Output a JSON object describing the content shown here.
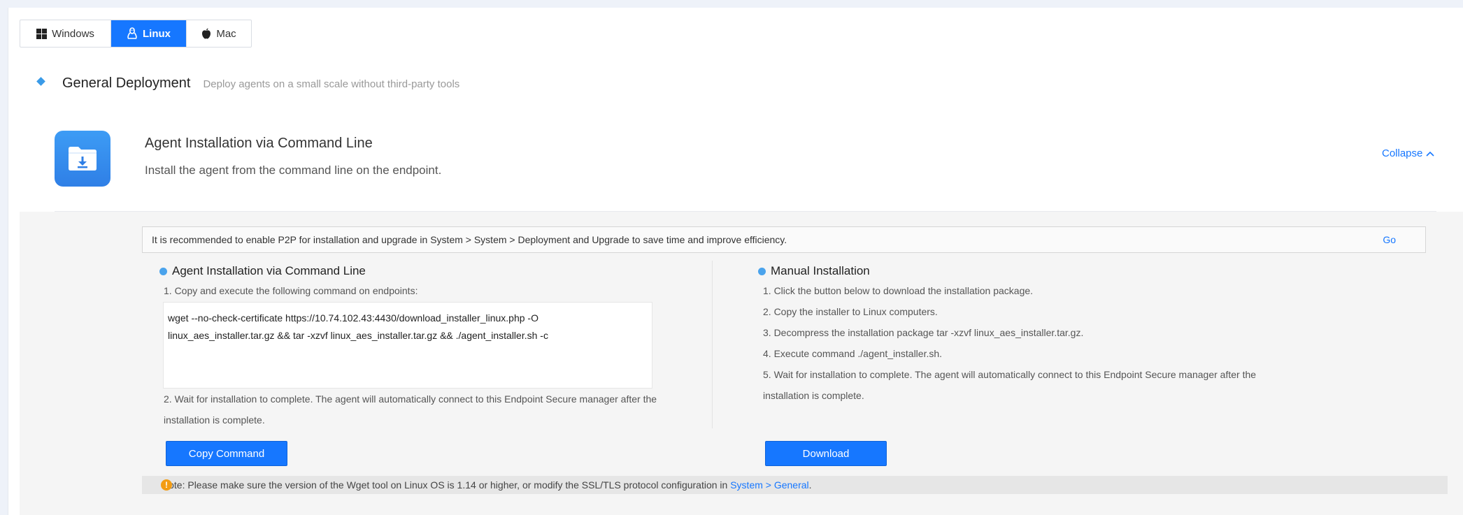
{
  "os_tabs": [
    {
      "label": "Windows",
      "icon": "windows-icon",
      "selected": false
    },
    {
      "label": "Linux",
      "icon": "linux-icon",
      "selected": true
    },
    {
      "label": "Mac",
      "icon": "apple-icon",
      "selected": false
    }
  ],
  "section": {
    "title": "General Deployment",
    "description": "Deploy agents on a small scale without third-party tools"
  },
  "card": {
    "icon": "folder-download-icon",
    "title": "Agent Installation via Command Line",
    "subtitle": "Install the agent from the command line on the endpoint.",
    "collapse_label": "Collapse"
  },
  "p2p_notice": {
    "text": "It is recommended to enable P2P for installation and upgrade in System > System > Deployment and Upgrade to save time and improve efficiency.",
    "go_label": "Go"
  },
  "cli": {
    "title": "Agent Installation via Command Line",
    "step1": "1. Copy and execute the following command on endpoints:",
    "command_line1": "wget --no-check-certificate https://10.74.102.43:4430/download_installer_linux.php -O",
    "command_line2": "linux_aes_installer.tar.gz && tar -xzvf linux_aes_installer.tar.gz && ./agent_installer.sh -c",
    "step2_line1": "2. Wait for installation to complete. The agent will automatically connect to this Endpoint Secure manager after the",
    "step2_line2": "installation is complete.",
    "button_label": "Copy Command"
  },
  "manual": {
    "title": "Manual Installation",
    "steps": [
      "1. Click the button below to download the installation package.",
      "2. Copy the installer to Linux computers.",
      "3. Decompress the installation package tar -xzvf linux_aes_installer.tar.gz.",
      "4. Execute command ./agent_installer.sh.",
      "5. Wait for installation to complete. The agent will automatically connect to this Endpoint Secure manager after the",
      "installation is complete."
    ],
    "button_label": "Download"
  },
  "note": {
    "icon": "warning-icon",
    "icon_glyph": "!",
    "text": "Note: Please make sure the version of the Wget tool on Linux OS is 1.14 or higher, or modify the SSL/TLS protocol configuration in ",
    "link": "System > General",
    "suffix": "."
  },
  "colors": {
    "accent": "#1677ff",
    "dot": "#4aa3ec",
    "warning": "#f39c12"
  }
}
